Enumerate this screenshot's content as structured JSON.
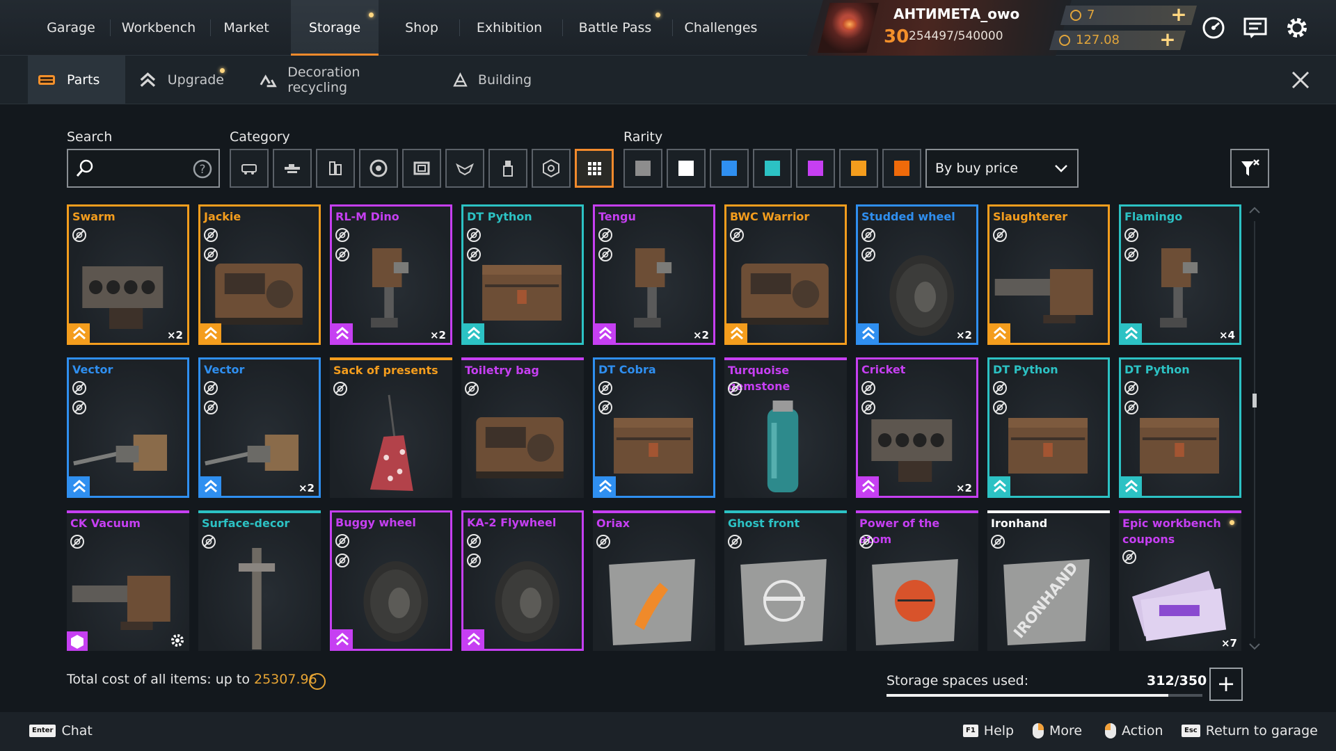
{
  "nav": {
    "tabs": [
      {
        "label": "Garage"
      },
      {
        "label": "Workbench"
      },
      {
        "label": "Market"
      },
      {
        "label": "Storage",
        "active": true,
        "dot": true
      },
      {
        "label": "Shop"
      },
      {
        "label": "Exhibition"
      },
      {
        "label": "Battle Pass",
        "dot": true
      },
      {
        "label": "Challenges"
      }
    ]
  },
  "profile": {
    "username": "АНТИМЕТА_owo",
    "level": "30",
    "xp": "254497/540000",
    "currency_coins": "7",
    "currency_money": "127.08"
  },
  "subnav": {
    "tabs": [
      {
        "label": "Parts",
        "icon": "parts-icon",
        "active": true
      },
      {
        "label": "Upgrade",
        "icon": "upgrade-icon",
        "dot": true
      },
      {
        "label": "Decoration recycling",
        "icon": "recycling-icon"
      },
      {
        "label": "Building",
        "icon": "building-icon"
      }
    ]
  },
  "filters": {
    "search_label": "Search",
    "search_value": "",
    "category_label": "Category",
    "rarity_label": "Rarity",
    "categories": [
      "cabins",
      "weapons",
      "modules",
      "wheels",
      "frames",
      "decor",
      "paint",
      "hardware",
      "all"
    ],
    "rarities": [
      "#8d8d8d",
      "#ffffff",
      "#2f8ff0",
      "#2cc2c4",
      "#c63ff2",
      "#f49d1d",
      "#f06a0a"
    ],
    "sort_value": "By buy price"
  },
  "colors": {
    "legendary": "#f49d1d",
    "epic": "#c63ff2",
    "special": "#2cc2c4",
    "rare": "#2f8ff0",
    "common": "#ffffff",
    "accent": "#f38a2c"
  },
  "items": [
    {
      "name": "Swarm",
      "rarity": "legendary",
      "icons": 1,
      "badge": true,
      "qty": "×2"
    },
    {
      "name": "Jackie",
      "rarity": "legendary",
      "icons": 2,
      "badge": true,
      "qty": ""
    },
    {
      "name": "RL-M Dino",
      "rarity": "epic",
      "icons": 2,
      "badge": true,
      "qty": "×2"
    },
    {
      "name": "DT Python",
      "rarity": "special",
      "icons": 2,
      "badge": true,
      "qty": ""
    },
    {
      "name": "Tengu",
      "rarity": "epic",
      "icons": 2,
      "badge": true,
      "qty": "×2"
    },
    {
      "name": "BWC Warrior",
      "rarity": "legendary",
      "icons": 1,
      "badge": true,
      "qty": ""
    },
    {
      "name": "Studded wheel",
      "rarity": "rare",
      "icons": 2,
      "badge": true,
      "qty": "×2"
    },
    {
      "name": "Slaughterer",
      "rarity": "legendary",
      "icons": 1,
      "badge": true,
      "qty": ""
    },
    {
      "name": "Flamingo",
      "rarity": "special",
      "icons": 2,
      "badge": true,
      "qty": "×4"
    },
    {
      "name": "Vector",
      "rarity": "rare",
      "icons": 2,
      "badge": true,
      "qty": ""
    },
    {
      "name": "Vector",
      "rarity": "rare",
      "icons": 2,
      "badge": true,
      "qty": "×2"
    },
    {
      "name": "Sack of presents",
      "rarity": "legendary",
      "icons": 1,
      "badge": false,
      "qty": "",
      "top_only": true
    },
    {
      "name": "Toiletry bag",
      "rarity": "epic",
      "icons": 1,
      "badge": false,
      "qty": "",
      "top_only": true
    },
    {
      "name": "DT Cobra",
      "rarity": "rare",
      "icons": 2,
      "badge": true,
      "qty": ""
    },
    {
      "name": "Turquoise gemstone",
      "rarity": "epic",
      "icons": 1,
      "badge": false,
      "qty": "",
      "top_only": true
    },
    {
      "name": "Cricket",
      "rarity": "epic",
      "icons": 2,
      "badge": true,
      "qty": "×2"
    },
    {
      "name": "DT Python",
      "rarity": "special",
      "icons": 2,
      "badge": true,
      "qty": ""
    },
    {
      "name": "DT Python",
      "rarity": "special",
      "icons": 2,
      "badge": true,
      "qty": ""
    },
    {
      "name": "CK Vacuum",
      "rarity": "epic",
      "icons": 1,
      "badge": true,
      "qty": "",
      "gear": true,
      "top_only": true
    },
    {
      "name": "Surface-decor",
      "rarity": "special",
      "icons": 1,
      "badge": false,
      "qty": "",
      "top_only": true
    },
    {
      "name": "Buggy wheel",
      "rarity": "epic",
      "icons": 2,
      "badge": true,
      "qty": ""
    },
    {
      "name": "KA-2 Flywheel",
      "rarity": "epic",
      "icons": 2,
      "badge": true,
      "qty": ""
    },
    {
      "name": "Oriax",
      "rarity": "epic",
      "icons": 1,
      "badge": false,
      "qty": "",
      "top_only": true
    },
    {
      "name": "Ghost front",
      "rarity": "special",
      "icons": 1,
      "badge": false,
      "qty": "",
      "top_only": true
    },
    {
      "name": "Power of the atom",
      "rarity": "epic",
      "icons": 1,
      "badge": false,
      "qty": "",
      "top_only": true
    },
    {
      "name": "Ironhand",
      "rarity": "common",
      "icons": 1,
      "badge": false,
      "qty": "",
      "top_only": true
    },
    {
      "name": "Epic workbench coupons",
      "rarity": "epic",
      "icons": 1,
      "badge": false,
      "qty": "×7",
      "top_only": true,
      "dot": true
    }
  ],
  "summary": {
    "total_label": "Total cost of all items: up to",
    "total_value": "25307.96",
    "storage_label": "Storage spaces used:",
    "storage_value": "312/350",
    "storage_fraction": 0.891
  },
  "footer": {
    "chat_key": "Enter",
    "chat_label": "Chat",
    "help_key": "F1",
    "help_label": "Help",
    "more_label": "More",
    "action_label": "Action",
    "return_key": "Esc",
    "return_label": "Return to garage"
  }
}
